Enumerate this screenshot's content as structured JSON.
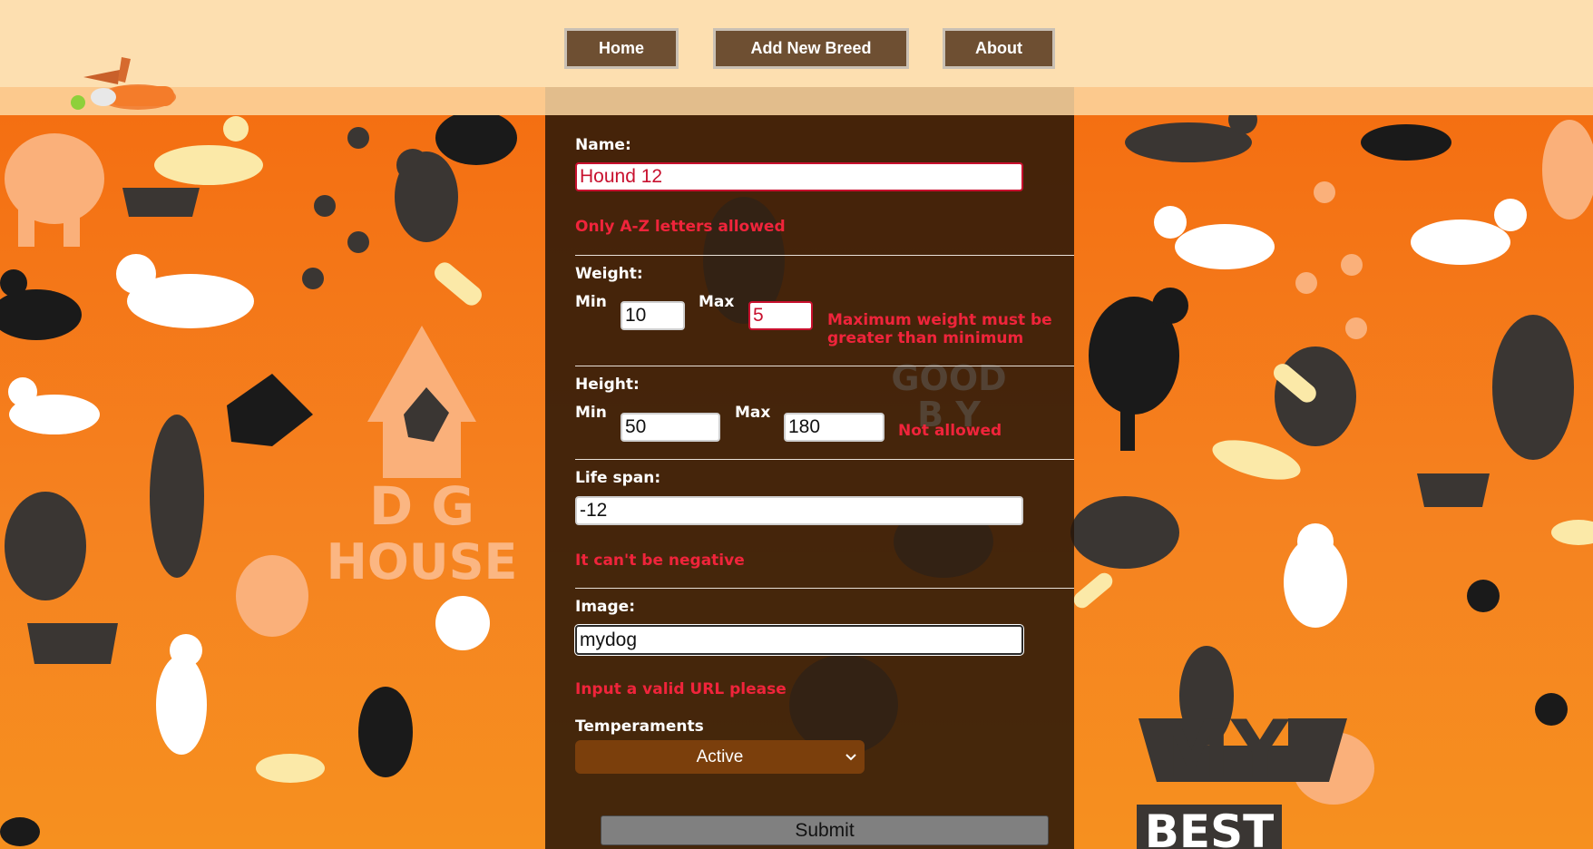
{
  "nav": {
    "home": "Home",
    "add_breed": "Add New Breed",
    "about": "About"
  },
  "background": {
    "left_sign_line1": "D  G",
    "left_sign_line2": "HOUSE",
    "center_sign_line1": "GOOD",
    "center_sign_line2": "B  Y",
    "right_sign_line1": "MY",
    "right_sign_line2": "BEST"
  },
  "form": {
    "name": {
      "label": "Name:",
      "value": "Hound 12",
      "error": "Only A-Z letters allowed"
    },
    "weight": {
      "label": "Weight:",
      "min_label": "Min",
      "min_value": "10",
      "max_label": "Max",
      "max_value": "5",
      "error_line1": "Maximum weight must be",
      "error_line2": "greater than minimum"
    },
    "height": {
      "label": "Height:",
      "min_label": "Min",
      "min_value": "50",
      "max_label": "Max",
      "max_value": "180",
      "error": "Not allowed"
    },
    "life_span": {
      "label": "Life span:",
      "value": "-12",
      "error": "It can't be negative"
    },
    "image": {
      "label": "Image:",
      "value": "mydog",
      "error": "Input a valid URL please"
    },
    "temperaments": {
      "label": "Temperaments",
      "selected": "Active"
    },
    "submit": "Submit"
  },
  "colors": {
    "header": "#fddfb0",
    "nav_button": "#6e4f32",
    "error": "#f0243b",
    "select": "#7b3f0c",
    "background": "#f47c20"
  }
}
